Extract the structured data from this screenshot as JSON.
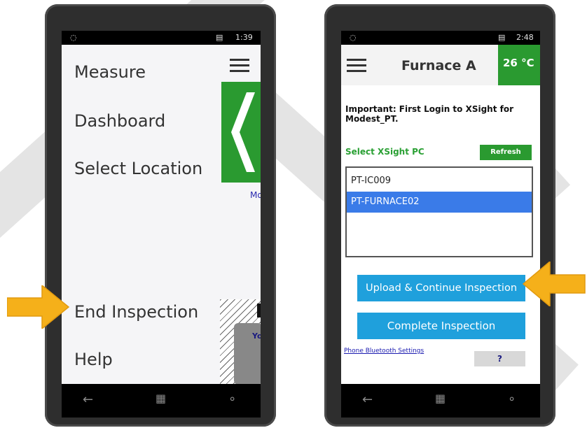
{
  "left_phone": {
    "status_time": "1:39",
    "menu_items": [
      "Measure",
      "Dashboard",
      "Select Location",
      "End Inspection",
      "Help"
    ],
    "partial_link": "Mo",
    "partial_banner": "You"
  },
  "right_phone": {
    "status_time": "2:48",
    "title": "Furnace A",
    "temperature": "26 °C",
    "important_text": "Important: First Login to XSight for Modest_PT.",
    "select_label": "Select XSight PC",
    "refresh_label": "Refresh",
    "pc_list": [
      {
        "name": "PT-IC009",
        "selected": false
      },
      {
        "name": "PT-FURNACE02",
        "selected": true
      }
    ],
    "upload_button": "Upload & Continue Inspection",
    "complete_button": "Complete Inspection",
    "bluetooth_link": "Phone Bluetooth Settings",
    "help_button": "?"
  },
  "colors": {
    "accent_green": "#2a9a30",
    "button_blue": "#1fa0dc",
    "selected_blue": "#3a7be8",
    "arrow_orange": "#f5b01a"
  }
}
